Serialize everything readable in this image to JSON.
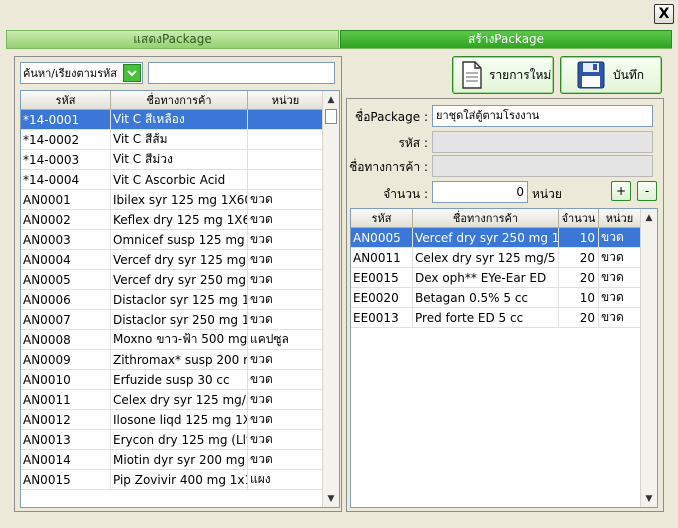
{
  "window": {
    "close_label": "X"
  },
  "tabs": {
    "show": "แสดงPackage",
    "create": "สร้างPackage"
  },
  "search": {
    "mode": "ค้นหา/เรียงตามรหัส",
    "value": ""
  },
  "left_grid": {
    "headers": [
      "รหัส",
      "ชื่อทางการค้า",
      "หน่วย"
    ],
    "rows": [
      [
        "*14-0001",
        "Vit C สีเหลือง",
        ""
      ],
      [
        "*14-0002",
        "Vit C สีส้ม",
        ""
      ],
      [
        "*14-0003",
        "Vit C สีม่วง",
        ""
      ],
      [
        "*14-0004",
        "Vit C Ascorbic Acid",
        ""
      ],
      [
        "AN0001",
        "Ibilex syr 125 mg 1X60",
        "ขวด"
      ],
      [
        "AN0002",
        "Keflex dry 125 mg 1X6",
        "ขวด"
      ],
      [
        "AN0003",
        "Omnicef susp 125 mg",
        "ขวด"
      ],
      [
        "AN0004",
        "Vercef dry syr 125 mg",
        "ขวด"
      ],
      [
        "AN0005",
        "Vercef dry syr 250 mg",
        "ขวด"
      ],
      [
        "AN0006",
        "Distaclor syr 125 mg 1>",
        "ขวด"
      ],
      [
        "AN0007",
        "Distaclor syr 250 mg 1>",
        "ขวด"
      ],
      [
        "AN0008",
        "Moxno ขาว-ฟ้า 500 mg",
        "แคปซูล"
      ],
      [
        "AN0009",
        "Zithromax* susp 200 m",
        "ขวด"
      ],
      [
        "AN0010",
        "Erfuzide susp 30 cc",
        "ขวด"
      ],
      [
        "AN0011",
        "Celex dry syr 125 mg/5",
        "ขวด"
      ],
      [
        "AN0012",
        "Ilosone liqd 125 mg 1X",
        "ขวด"
      ],
      [
        "AN0013",
        "Erycon dry 125 mg (Llv",
        "ขวด"
      ],
      [
        "AN0014",
        "Miotin dyr syr 200 mg",
        "ขวด"
      ],
      [
        "AN0015",
        "Pip Zovivir 400 mg 1x1",
        "แผง"
      ]
    ]
  },
  "toolbar": {
    "new_label": "รายการใหม่",
    "save_label": "บันทึก"
  },
  "form": {
    "package_label": "ชื่อPackage :",
    "package_value": "ยาชุดใส่ตู้ตามโรงงาน",
    "code_label": "รหัส :",
    "trade_label": "ชื่อทางการค้า :",
    "qty_label": "จำนวน :",
    "qty_value": "0",
    "unit_label": "หน่วย",
    "plus": "+",
    "minus": "-"
  },
  "right_grid": {
    "headers": [
      "รหัส",
      "ชื่อทางการค้า",
      "จำนวน",
      "หน่วย"
    ],
    "rows": [
      [
        "AN0005",
        "Vercef dry syr 250 mg 1>",
        "10",
        "ขวด"
      ],
      [
        "AN0011",
        "Celex dry syr 125 mg/5",
        "20",
        "ขวด"
      ],
      [
        "EE0015",
        "Dex oph** EYe-Ear ED",
        "20",
        "ขวด"
      ],
      [
        "EE0020",
        "Betagan 0.5% 5 cc",
        "10",
        "ขวด"
      ],
      [
        "EE0013",
        "Pred forte ED 5 cc",
        "20",
        "ขวด"
      ]
    ]
  },
  "colors": {
    "tab_active": "#2ea420",
    "selection": "#3b77d6"
  }
}
